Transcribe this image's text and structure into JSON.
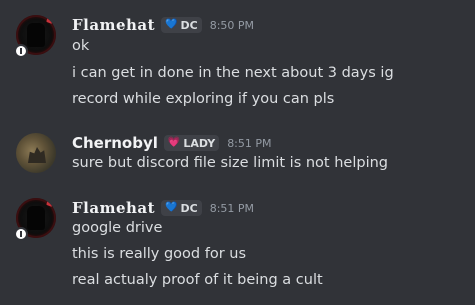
{
  "messages": [
    {
      "username": "Flamehat",
      "tag": {
        "heart": "💙",
        "label": "DC"
      },
      "time": "8:50 PM",
      "lines": [
        "ok",
        "i can get in done in the next about 3 days ig",
        "record while exploring if you can pls"
      ]
    },
    {
      "username": "Chernobyl",
      "tag": {
        "heart": "💗",
        "label": "LADY"
      },
      "time": "8:51 PM",
      "lines": [
        "sure but discord file size limit is not helping"
      ]
    },
    {
      "username": "Flamehat",
      "tag": {
        "heart": "💙",
        "label": "DC"
      },
      "time": "8:51 PM",
      "lines": [
        "google drive",
        "this is really good for us",
        "real actualy proof of it being a cult"
      ]
    }
  ],
  "colors": {
    "background": "#313338",
    "text": "#dbdee1",
    "timestamp": "#949ba4"
  },
  "icons": [
    "user-avatar",
    "status-badge-icon",
    "heart-icon"
  ]
}
